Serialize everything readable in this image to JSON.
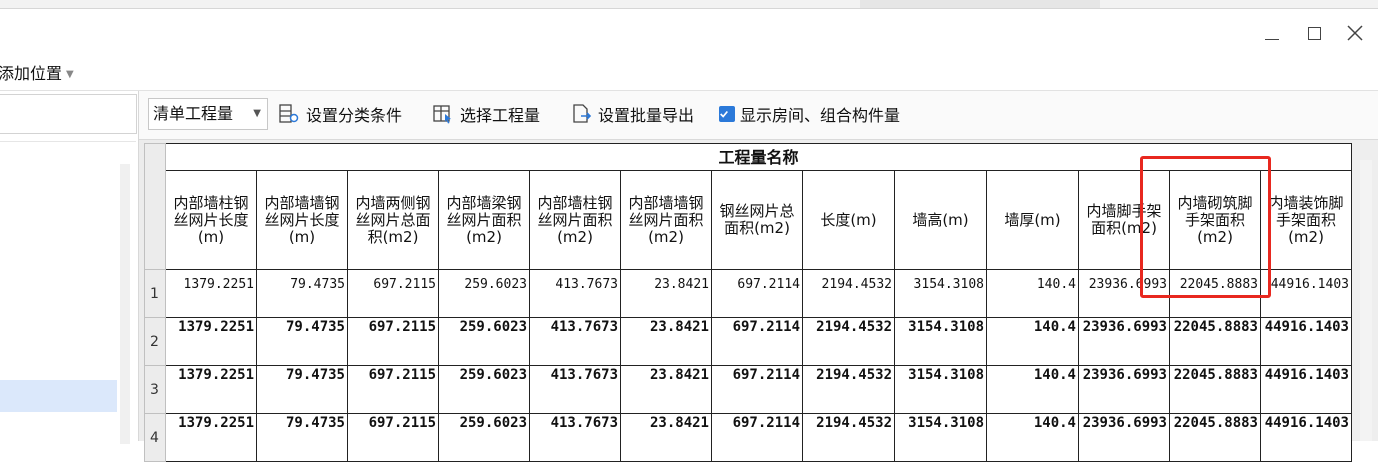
{
  "window": {
    "minimize_icon": "minimize-icon",
    "maximize_icon": "maximize-icon",
    "close_icon": "close-icon"
  },
  "row2": {
    "add_position_label": "添加位置",
    "dropdown_icon": "caret-down-icon"
  },
  "toolbar": {
    "quantity_select_value": "清单工程量",
    "set_category_label": "设置分类条件",
    "select_quantity_label": "选择工程量",
    "batch_export_label": "设置批量导出",
    "show_rooms_label": "显示房间、组合构件量",
    "show_rooms_checked": true,
    "accent_color": "#2b79d9"
  },
  "grid": {
    "group_header": "工程量名称",
    "columns": [
      "内部墙柱钢丝网片长度(m)",
      "内部墙墙钢丝网片长度(m)",
      "内墙两侧钢丝网片总面积(m2)",
      "内部墙梁钢丝网片面积(m2)",
      "内部墙柱钢丝网片面积(m2)",
      "内部墙墙钢丝网片面积(m2)",
      "钢丝网片总面积(m2)",
      "长度(m)",
      "墙高(m)",
      "墙厚(m)",
      "内墙脚手架面积(m2)",
      "内墙砌筑脚手架面积(m2)",
      "内墙装饰脚手架面积(m2)"
    ],
    "rows": [
      {
        "num": "1",
        "values": [
          "1379.2251",
          "79.4735",
          "697.2115",
          "259.6023",
          "413.7673",
          "23.8421",
          "697.2114",
          "2194.4532",
          "3154.3108",
          "140.4",
          "23936.6993",
          "22045.8883",
          "44916.1403"
        ]
      },
      {
        "num": "2",
        "values": [
          "1379.2251",
          "79.4735",
          "697.2115",
          "259.6023",
          "413.7673",
          "23.8421",
          "697.2114",
          "2194.4532",
          "3154.3108",
          "140.4",
          "23936.6993",
          "22045.8883",
          "44916.1403"
        ]
      },
      {
        "num": "3",
        "values": [
          "1379.2251",
          "79.4735",
          "697.2115",
          "259.6023",
          "413.7673",
          "23.8421",
          "697.2114",
          "2194.4532",
          "3154.3108",
          "140.4",
          "23936.6993",
          "22045.8883",
          "44916.1403"
        ]
      },
      {
        "num": "4",
        "values": [
          "1379.2251",
          "79.4735",
          "697.2115",
          "259.6023",
          "413.7673",
          "23.8421",
          "697.2114",
          "2194.4532",
          "3154.3108",
          "140.4",
          "23936.6993",
          "22045.8883",
          "44916.1403"
        ]
      }
    ],
    "highlight_color": "#e8281f"
  }
}
